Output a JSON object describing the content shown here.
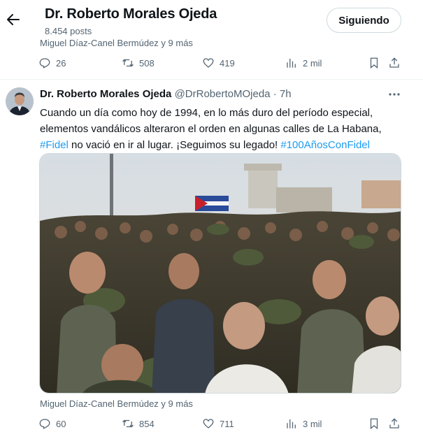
{
  "header": {
    "name": "Dr. Roberto Morales Ojeda",
    "posts": "8.454 posts",
    "follow_label": "Siguiendo"
  },
  "prev_tweet": {
    "reposted_by": "Miguel Díaz-Canel Bermúdez y 9 más",
    "replies": "26",
    "reposts": "508",
    "likes": "419",
    "views": "2 mil"
  },
  "tweet": {
    "author_name": "Dr. Roberto Morales Ojeda",
    "handle": "@DrRobertoMOjeda",
    "separator": "·",
    "time": "7h",
    "text_line1": "Cuando un día como hoy de 1994, en lo más duro del período especial,",
    "text_line2": "elementos vandálicos alteraron el orden en algunas calles de La Habana,",
    "hashtag1": "#Fidel",
    "text_mid": " no vació  en ir al lugar. ¡Seguimos su legado! ",
    "hashtag2": "#100AñosConFidel",
    "reposted_by": "Miguel Díaz-Canel Bermúdez y 9 más",
    "replies": "60",
    "reposts": "854",
    "likes": "711",
    "views": "3 mil"
  },
  "icons": [
    "back-arrow-icon",
    "reply-icon",
    "repost-icon",
    "like-icon",
    "views-icon",
    "bookmark-icon",
    "share-icon",
    "more-icon"
  ],
  "colors": {
    "link": "#1d9bf0",
    "secondary_text": "#536471",
    "border": "#cfd9de"
  }
}
